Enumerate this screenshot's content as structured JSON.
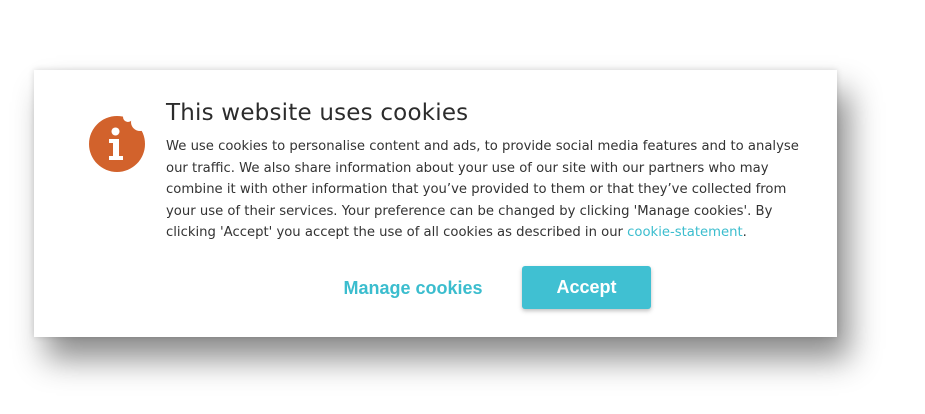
{
  "banner": {
    "title": "This website uses cookies",
    "text_before_link": "We use cookies to personalise content and ads, to provide social media features and to analyse our traffic. We also share information about your use of our site with our partners who may combine it with other information that you’ve provided to them or that they’ve collected from your use of their services. Your preference can be changed by clicking 'Manage cookies'. By clicking 'Accept' you accept the use of all cookies as described in our ",
    "link_text": "cookie-statement",
    "text_after_link": ".",
    "icon": "cookie-info-icon",
    "icon_color": "#d2622c"
  },
  "actions": {
    "manage_label": "Manage cookies",
    "accept_label": "Accept"
  },
  "colors": {
    "accent": "#3bbdce",
    "accept_bg": "#40c0d2",
    "title": "#2c2c2c",
    "text": "#333333"
  }
}
